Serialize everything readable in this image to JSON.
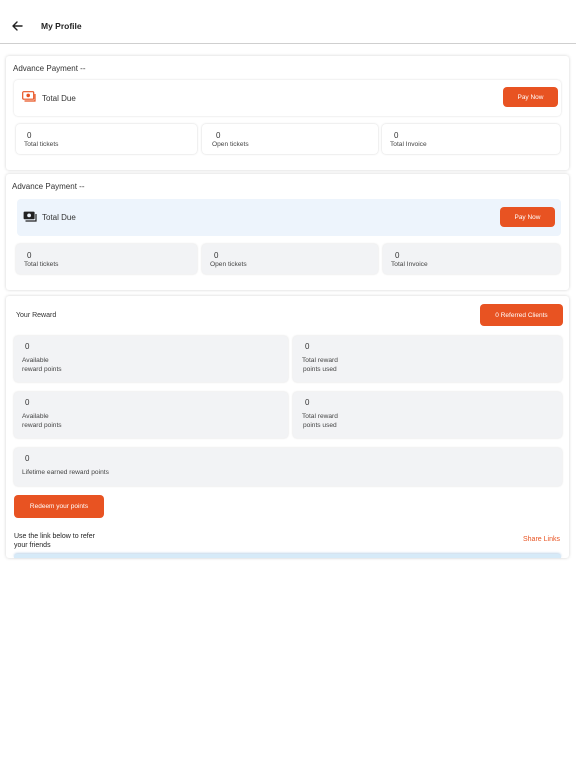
{
  "header": {
    "title": "My Profile",
    "back_icon": "arrow-left-icon"
  },
  "advance_payment_cards": [
    {
      "title": "Advance Payment --",
      "due_label": "Total Due",
      "pay_label": "Pay Now",
      "stats": [
        {
          "value": "0",
          "label": "Total tickets"
        },
        {
          "value": "0",
          "label": "Open tickets"
        },
        {
          "value": "0",
          "label": "Total Invoice"
        }
      ]
    },
    {
      "title": "Advance Payment --",
      "due_label": "Total Due",
      "pay_label": "Pay Now",
      "stats": [
        {
          "value": "0",
          "label": "Total tickets"
        },
        {
          "value": "0",
          "label": "Open tickets"
        },
        {
          "value": "0",
          "label": "Total Invoice"
        }
      ]
    }
  ],
  "reward": {
    "title": "Your Reward",
    "referred_button": "0 Referred Clients",
    "boxes": [
      {
        "value": "0",
        "label_line1": "Available",
        "label_line2": "reward points"
      },
      {
        "value": "0",
        "label_line1": "Total reward",
        "label_line2": "points used"
      },
      {
        "value": "0",
        "label_line1": "Available",
        "label_line2": "reward points"
      },
      {
        "value": "0",
        "label_line1": "Total reward",
        "label_line2": "points used"
      }
    ],
    "lifetime": {
      "value": "0",
      "label": "Lifetime earned reward  points"
    },
    "redeem_button": "Redeem your points",
    "refer_text_line1": "Use the link below to refer",
    "refer_text_line2": "your friends",
    "share_links": "Share Links"
  },
  "colors": {
    "accent": "#e85322",
    "due_row_bg": "#edf4fc",
    "stat_grey_bg": "#f2f3f5"
  }
}
